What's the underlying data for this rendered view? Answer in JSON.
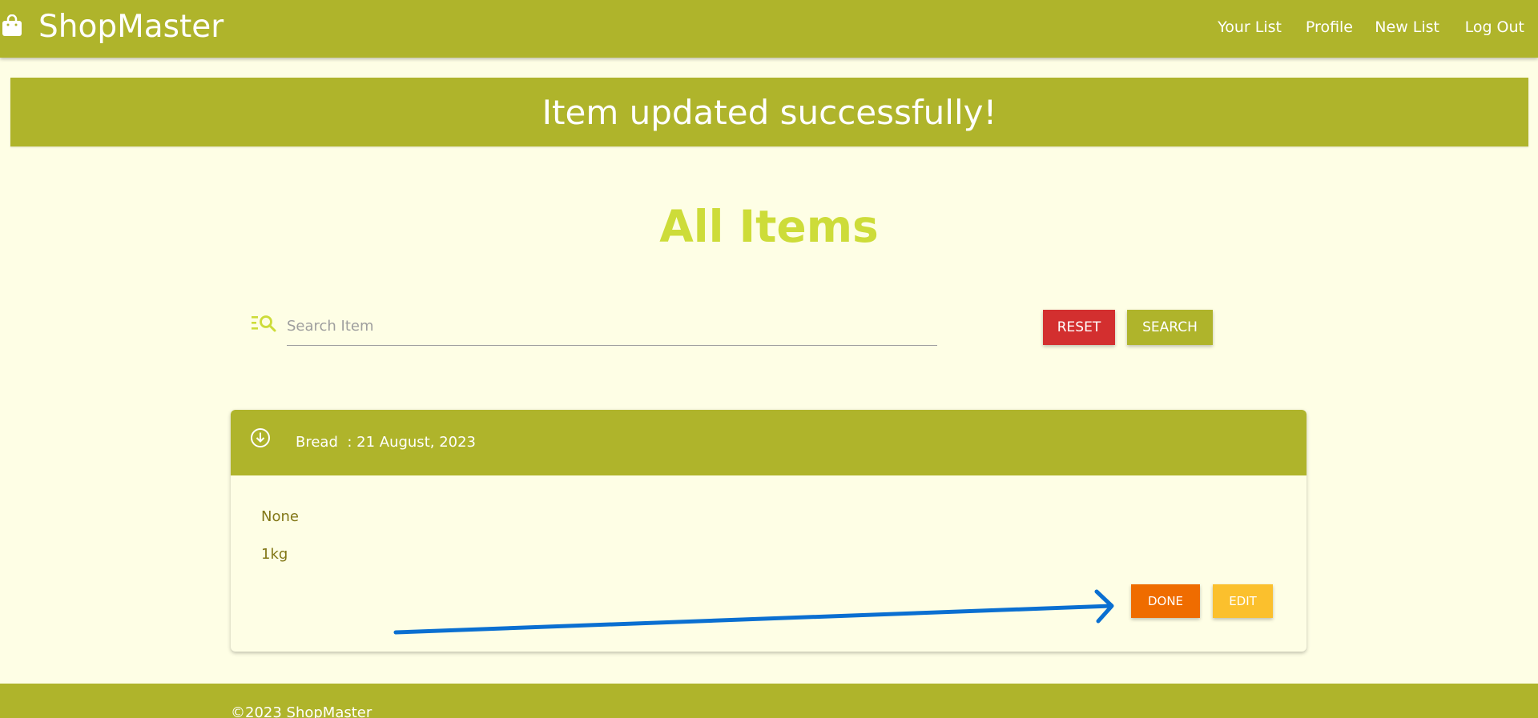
{
  "app": {
    "brand": "ShopMaster",
    "brand_icon": "shopping-bag-icon"
  },
  "nav": {
    "items": [
      {
        "label": "Your List"
      },
      {
        "label": "Profile"
      },
      {
        "label": "New List"
      },
      {
        "label": "Log Out"
      }
    ]
  },
  "alert": {
    "message": "Item updated successfully!"
  },
  "page": {
    "title": "All Items"
  },
  "search": {
    "icon": "list-search-icon",
    "placeholder": "Search Item",
    "value": "",
    "reset_label": "RESET",
    "search_label": "SEARCH"
  },
  "items": [
    {
      "name": "Bread",
      "date": ": 21 August, 2023",
      "note": "None",
      "quantity": "1kg",
      "done_label": "DONE",
      "edit_label": "EDIT",
      "icon": "circle-arrow-down-icon"
    }
  ],
  "footer": {
    "text": "©2023 ShopMaster"
  },
  "colors": {
    "primary": "#afb42b",
    "background": "#fefee5",
    "title": "#cddc39",
    "reset": "#d32f2f",
    "done": "#ef6c00",
    "edit": "#fbc02d",
    "arrow": "#0a6fd1"
  }
}
